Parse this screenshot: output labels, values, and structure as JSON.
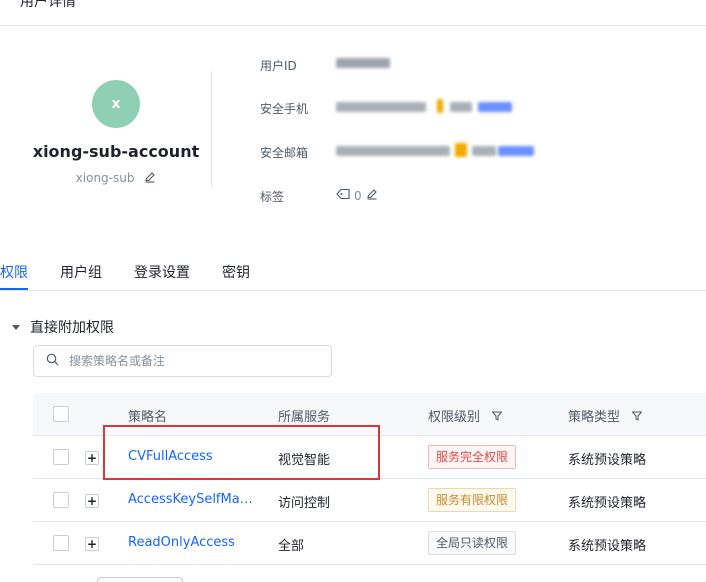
{
  "header": {
    "breadcrumb": "用户详情"
  },
  "user": {
    "avatar_letter": "x",
    "name": "xiong-sub-account",
    "alias": "xiong-sub",
    "avatar_color": "#8fd0b4"
  },
  "info": {
    "user_id_label": "用户ID",
    "phone_label": "安全手机",
    "email_label": "安全邮箱",
    "tags_label": "标签",
    "tag_count": "0"
  },
  "tabs": [
    {
      "label": "权限",
      "active": true
    },
    {
      "label": "用户组"
    },
    {
      "label": "登录设置"
    },
    {
      "label": "密钥"
    }
  ],
  "section": {
    "title": "直接附加权限"
  },
  "search": {
    "placeholder": "搜索策略名或备注"
  },
  "table": {
    "headers": [
      "策略名",
      "所属服务",
      "权限级别",
      "策略类型"
    ],
    "rows": [
      {
        "name": "CVFullAccess",
        "service": "视觉智能",
        "level": "服务完全权限",
        "type": "系统预设策略"
      },
      {
        "name": "AccessKeySelfMa…",
        "service": "访问控制",
        "level": "服务有限权限",
        "type": "系统预设策略"
      },
      {
        "name": "ReadOnlyAccess",
        "service": "全部",
        "level": "全局只读权限",
        "type": "系统预设策略"
      }
    ]
  },
  "colors": {
    "accent": "#1664ff",
    "highlight": "#d9363e"
  }
}
